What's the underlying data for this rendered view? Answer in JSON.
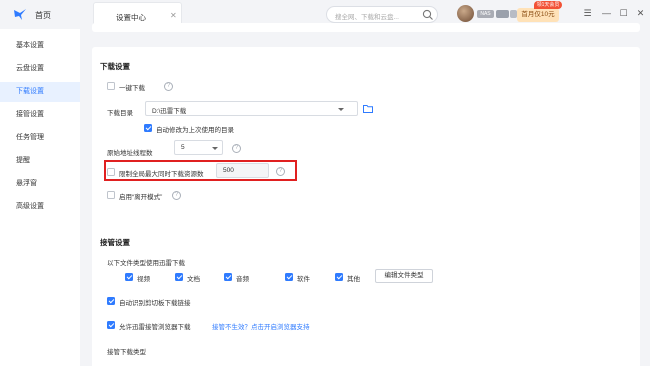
{
  "app": {
    "home_label": "首页",
    "tab_label": "设置中心",
    "search_placeholder": "搜全网、下载和云盘...",
    "user_badge": "NAS",
    "promo_label": "首月仅10元",
    "promo_tag": "领1天会员"
  },
  "sidebar": {
    "items": [
      {
        "label": "基本设置"
      },
      {
        "label": "云盘设置"
      },
      {
        "label": "下载设置",
        "active": true
      },
      {
        "label": "接管设置"
      },
      {
        "label": "任务管理"
      },
      {
        "label": "提醒"
      },
      {
        "label": "悬浮窗"
      },
      {
        "label": "高级设置"
      }
    ]
  },
  "download": {
    "title": "下载设置",
    "one_click": "一键下载",
    "dir_label": "下载目录",
    "dir_value": "D:\\迅雷下载",
    "auto_modify": "自动修改为上次使用的目录",
    "threads_label": "原始地址线程数",
    "threads_value": "5",
    "limit_label": "限制全局最大同时下载资源数",
    "limit_value": "500",
    "open_mode": "启用“离开模式”"
  },
  "takeover": {
    "title": "接管设置",
    "filetype_label": "以下文件类型使用迅雷下载",
    "types": [
      "视频",
      "文档",
      "音频",
      "软件",
      "其他"
    ],
    "edit_btn": "编辑文件类型",
    "auto_clipboard": "自动识别剪切板下载链接",
    "browser_takeover": "允许迅雷接管浏览器下载",
    "browser_link": "接管不生效？点击开启浏览器支持",
    "download_type_label": "接管下载类型"
  },
  "colors": {
    "accent": "#2f7bff",
    "highlight": "#e02020",
    "promo_bg": "#ffe2b8",
    "promo_tag": "#f25236"
  }
}
